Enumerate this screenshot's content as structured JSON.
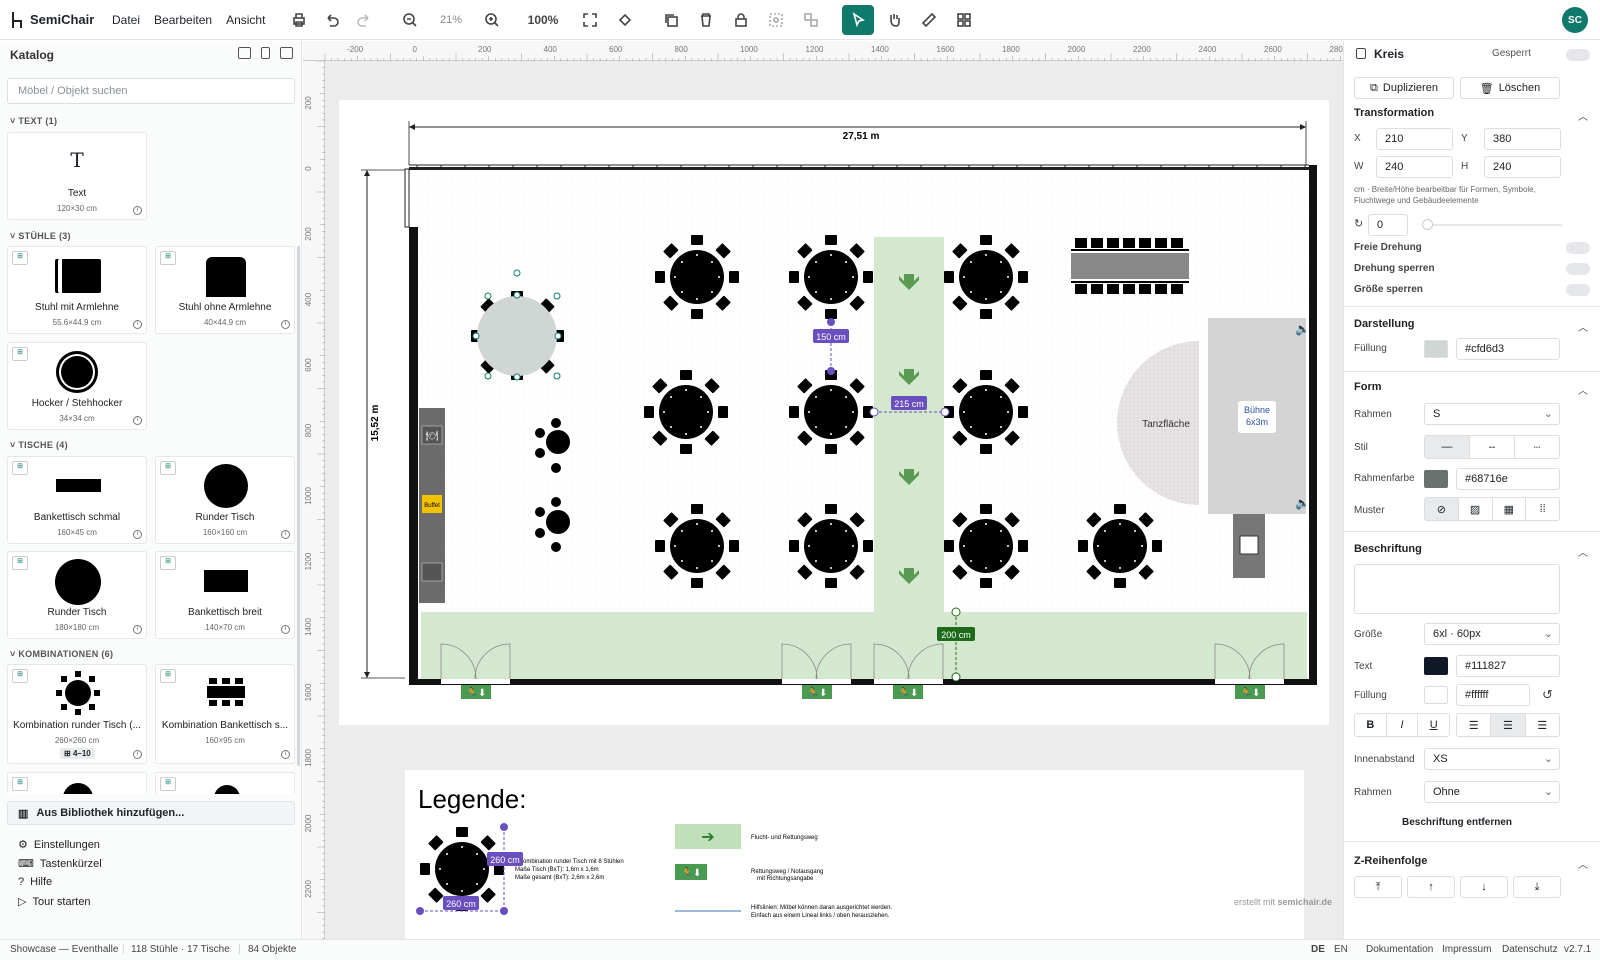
{
  "app": {
    "name": "SemiChair",
    "avatar": "SC"
  },
  "menu": [
    "Datei",
    "Bearbeiten",
    "Ansicht"
  ],
  "toolbar": {
    "zoom_percent": "21%",
    "zoom_reset": "100%"
  },
  "catalog": {
    "title": "Katalog",
    "search_placeholder": "Möbel / Objekt suchen",
    "sections": [
      {
        "label": "TEXT (1)"
      },
      {
        "label": "STÜHLE (3)"
      },
      {
        "label": "TISCHE (4)"
      },
      {
        "label": "KOMBINATIONEN (6)"
      }
    ],
    "items": [
      {
        "name": "Text",
        "dims": "120×30 cm",
        "icon": "text-icon"
      },
      {
        "name": "Stuhl mit Armlehne",
        "dims": "55.6×44.9 cm",
        "icon": "armchair-icon"
      },
      {
        "name": "Stuhl ohne Armlehne",
        "dims": "40×44.9 cm",
        "icon": "chair-icon"
      },
      {
        "name": "Hocker / Stehhocker",
        "dims": "34×34 cm",
        "icon": "stool-icon"
      },
      {
        "name": "Bankettisch schmal",
        "dims": "160×45 cm",
        "icon": "narrow-table-icon"
      },
      {
        "name": "Runder Tisch",
        "dims": "160×160 cm",
        "icon": "round-table-icon"
      },
      {
        "name": "Runder Tisch",
        "dims": "180×180 cm",
        "icon": "round-table-icon"
      },
      {
        "name": "Bankettisch breit",
        "dims": "140×70 cm",
        "icon": "wide-table-icon"
      },
      {
        "name": "Kombination runder Tisch (...",
        "dims": "260×260 cm",
        "extra": "4–10",
        "icon": "round-combo-icon"
      },
      {
        "name": "Kombination Bankettisch s...",
        "dims": "160×95 cm",
        "icon": "banquet-combo-icon"
      }
    ],
    "add_library": "Aus Bibliothek hinzufügen...",
    "links": [
      "Einstellungen",
      "Tastenkürzel",
      "Hilfe",
      "Tour starten"
    ]
  },
  "canvas": {
    "width_label": "27,51 m",
    "height_label": "15,52 m",
    "ruler_top": [
      "-200",
      "0",
      "200",
      "400",
      "600",
      "800",
      "1000",
      "1200",
      "1400",
      "1600",
      "1800",
      "2000",
      "2200",
      "2400",
      "2600",
      "2800"
    ],
    "ruler_left": [
      "200",
      "0",
      "200",
      "400",
      "600",
      "800",
      "1000",
      "1200",
      "1400",
      "1600",
      "1800",
      "2000",
      "2200"
    ],
    "measures": {
      "a": "150 cm",
      "b": "215 cm",
      "c": "200 cm",
      "d": "260 cm",
      "e": "260 cm"
    },
    "dance_floor": "Tanzfläche",
    "stage": "Bühne\n6x3m",
    "buffet": "Buffet",
    "legend_title": "Legende:",
    "legend_items": [
      "ombination runder Tisch mit 8 Stühlen",
      "Maße Tisch (BxT): 1,6m x 1,6m",
      "Maße gesamt (BxT): 2,6m x 2,6m",
      "Flucht- und Rettungsweg",
      "Rettungsweg / Notausgang",
      "mit Richtungsangabe",
      "Hilfslinien: Möbel können daran ausgerichtet werden.",
      "Einfach aus einem Lineal links / oben herausziehen."
    ],
    "watermark_prefix": "erstellt mit ",
    "watermark_brand": "semichair.de"
  },
  "panel": {
    "title": "Kreis",
    "locked": "Gesperrt",
    "duplicate": "Duplizieren",
    "delete": "Löschen",
    "transformation": "Transformation",
    "x_label": "X",
    "x": "210",
    "y_label": "Y",
    "y": "380",
    "w_label": "W",
    "w": "240",
    "h_label": "H",
    "h": "240",
    "hint": "cm · Breite/Höhe bearbeitbar für Formen, Symbole, Fluchtwege und Gebäudeelemente",
    "rotation": "0",
    "free_rotation": "Freie Drehung",
    "lock_rotation": "Drehung sperren",
    "lock_size": "Größe sperren",
    "appearance": "Darstellung",
    "fill_label": "Füllung",
    "fill_hex": "#cfd6d3",
    "fill_color": "#cfd6d3",
    "form": "Form",
    "border_label": "Rahmen",
    "border_value": "S",
    "style_label": "Stil",
    "border_color_label": "Rahmenfarbe",
    "border_color_hex": "#68716e",
    "border_color": "#68716e",
    "pattern_label": "Muster",
    "caption": "Beschriftung",
    "size_label": "Größe",
    "size_value": "6xl · 60px",
    "text_label": "Text",
    "text_hex": "#111827",
    "text_color": "#111827",
    "fill2_label": "Füllung",
    "fill2_hex": "#ffffff",
    "padding_label": "Innenabstand",
    "padding_value": "XS",
    "frame_label": "Rahmen",
    "frame_value": "Ohne",
    "remove_caption": "Beschriftung entfernen",
    "zorder": "Z-Reihenfolge"
  },
  "status": {
    "project": "Showcase — Eventhalle",
    "counts": "118 Stühle · 17 Tische",
    "objects": "84 Objekte",
    "lang_de": "DE",
    "lang_en": "EN",
    "docs": "Dokumentation",
    "imprint": "Impressum",
    "privacy": "Datenschutz",
    "version": "v2.7.1"
  }
}
